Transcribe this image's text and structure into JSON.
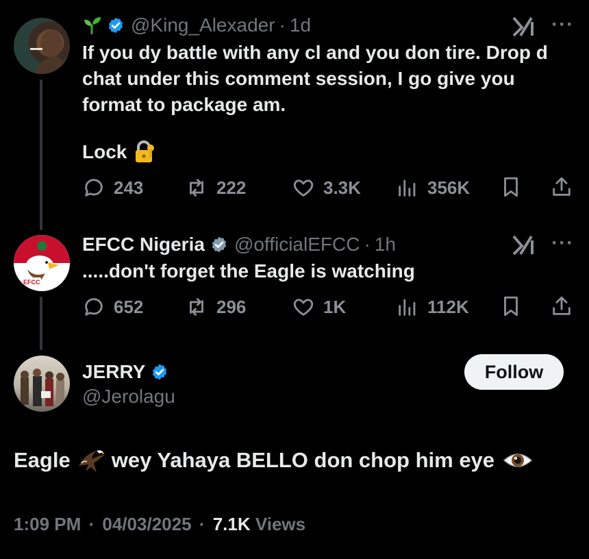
{
  "tweet1": {
    "handle": "@King_Alexader",
    "sep": "·",
    "time": "1d",
    "lines": [
      "If you dy battle with any cl and you don tire. Drop d",
      "chat under this comment session, I go give you",
      "format to package am."
    ],
    "lock_text": "Lock",
    "stats": {
      "replies": "243",
      "reposts": "222",
      "likes": "3.3K",
      "views": "356K"
    }
  },
  "tweet2": {
    "name": "EFCC Nigeria",
    "handle": "@officialEFCC",
    "sep": "·",
    "time": "1h",
    "avatar_label": "EFCC",
    "text": ".....don't forget the Eagle is watching",
    "stats": {
      "replies": "652",
      "reposts": "296",
      "likes": "1K",
      "views": "112K"
    }
  },
  "tweet3": {
    "name": "JERRY",
    "handle": "@Jerolagu",
    "follow_label": "Follow",
    "text_part1": "Eagle",
    "text_part2": "wey Yahaya BELLO don chop him eye",
    "meta": {
      "time": "1:09 PM",
      "sep1": "·",
      "date": "04/03/2025",
      "sep2": "·",
      "views_count": "7.1K",
      "views_label": "Views"
    }
  },
  "colors": {
    "background": "#000000",
    "text": "#e7e9ea",
    "muted": "#71767b",
    "verified": "#1d9bf0",
    "follow_bg": "#eff3f4"
  },
  "icons": [
    "sprout-icon",
    "verified-icon",
    "grok-icon",
    "more-icon",
    "reply-icon",
    "repost-icon",
    "like-icon",
    "views-icon",
    "bookmark-icon",
    "share-icon",
    "lock-icon",
    "eagle-icon",
    "eye-icon"
  ]
}
